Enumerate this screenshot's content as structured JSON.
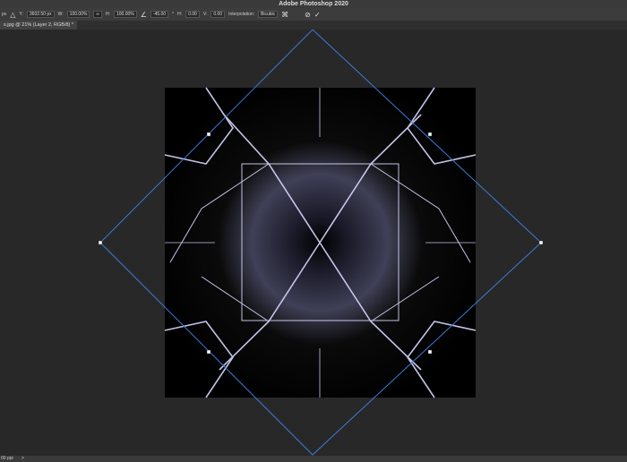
{
  "window": {
    "title": "Adobe Photoshop 2020"
  },
  "options": {
    "x_unit": "px",
    "y_label": "Y:",
    "y_value": "3602.50 px",
    "w_label": "W:",
    "w_value": "100.00%",
    "h_label": "H:",
    "h_value": "100.00%",
    "angle_value": "-45.00",
    "angle_unit": "°",
    "hskew_label": "H:",
    "hskew_value": "0.00",
    "vskew_label": "V:",
    "vskew_value": "0.00",
    "interp_label": "Interpolation:",
    "interp_value": "Bicubic"
  },
  "tab": {
    "label": "s.jpg @ 21% (Layer 2, RGB/8) *"
  },
  "status": {
    "text": "00 ppi",
    "arrow": ">"
  }
}
